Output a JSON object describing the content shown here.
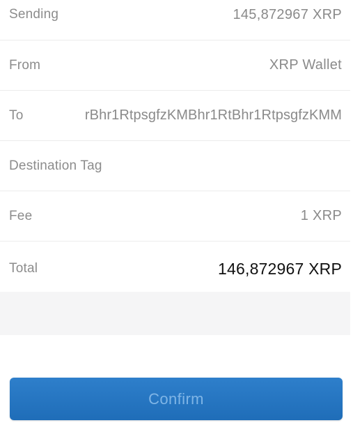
{
  "transaction": {
    "sending": {
      "label": "Sending",
      "value": "145,872967 XRP"
    },
    "from": {
      "label": "From",
      "value": "XRP Wallet"
    },
    "to": {
      "label": "To",
      "value": "rBhr1RtpsgfzKMBhr1RtBhr1RtpsgfzKMM"
    },
    "destination_tag": {
      "label": "Destination Tag",
      "value": ""
    },
    "fee": {
      "label": "Fee",
      "value": "1 XRP"
    },
    "total": {
      "label": "Total",
      "value": "146,872967 XRP"
    }
  },
  "actions": {
    "confirm_label": "Confirm"
  },
  "colors": {
    "button_blue": "#2476c2",
    "button_text": "#7fb5e6",
    "label_gray": "#8c8c8c",
    "total_text": "#111111"
  }
}
